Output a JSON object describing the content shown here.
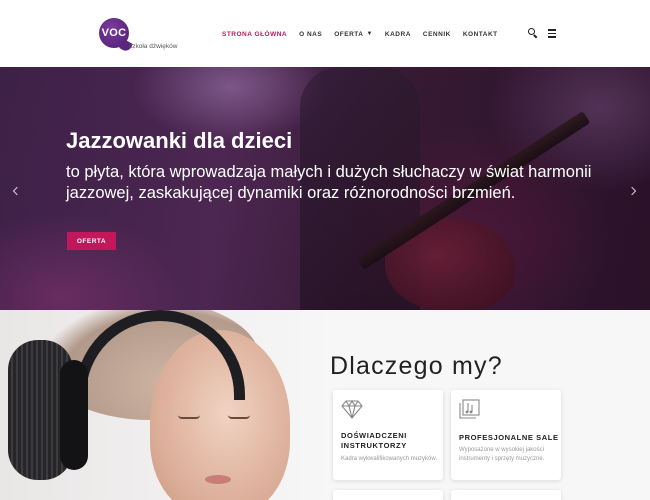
{
  "header": {
    "logo": {
      "text": "VOC",
      "subtitle": "szkoła dźwięków"
    },
    "nav": [
      {
        "label": "STRONA GŁÓWNA",
        "active": true
      },
      {
        "label": "O NAS",
        "active": false
      },
      {
        "label": "OFERTA",
        "active": false,
        "has_dropdown": true
      },
      {
        "label": "KADRA",
        "active": false
      },
      {
        "label": "CENNIK",
        "active": false
      },
      {
        "label": "KONTAKT",
        "active": false
      }
    ],
    "icons": [
      "search-icon",
      "menu-icon"
    ]
  },
  "hero": {
    "title": "Jazzowanki dla dzieci",
    "text": "to płyta, która wprowadzaja małych i dużych słuchaczy w świat harmonii jazzowej, zaskakującej dynamiki oraz różnorodności brzmień.",
    "button_label": "OFERTA",
    "arrows": [
      "chevron-left-icon",
      "chevron-right-icon"
    ]
  },
  "why": {
    "title": "Dlaczego my?",
    "cards": [
      {
        "icon": "diamond-icon",
        "title": "DOŚWIADCZENI INSTRUKTORZY",
        "text": "Kadra wykwalifikowanych muzyków."
      },
      {
        "icon": "media-icon",
        "title": "PROFESJONALNE SALE",
        "text": "Wyposażone w wysokiej jakości instrumenty i sprzęty muzyczne."
      }
    ]
  },
  "colors": {
    "accent": "#c2185b",
    "logo_purple": "#5a2680",
    "hero_dark": "#3a1a3c",
    "section_bg": "#f7f7f7"
  }
}
